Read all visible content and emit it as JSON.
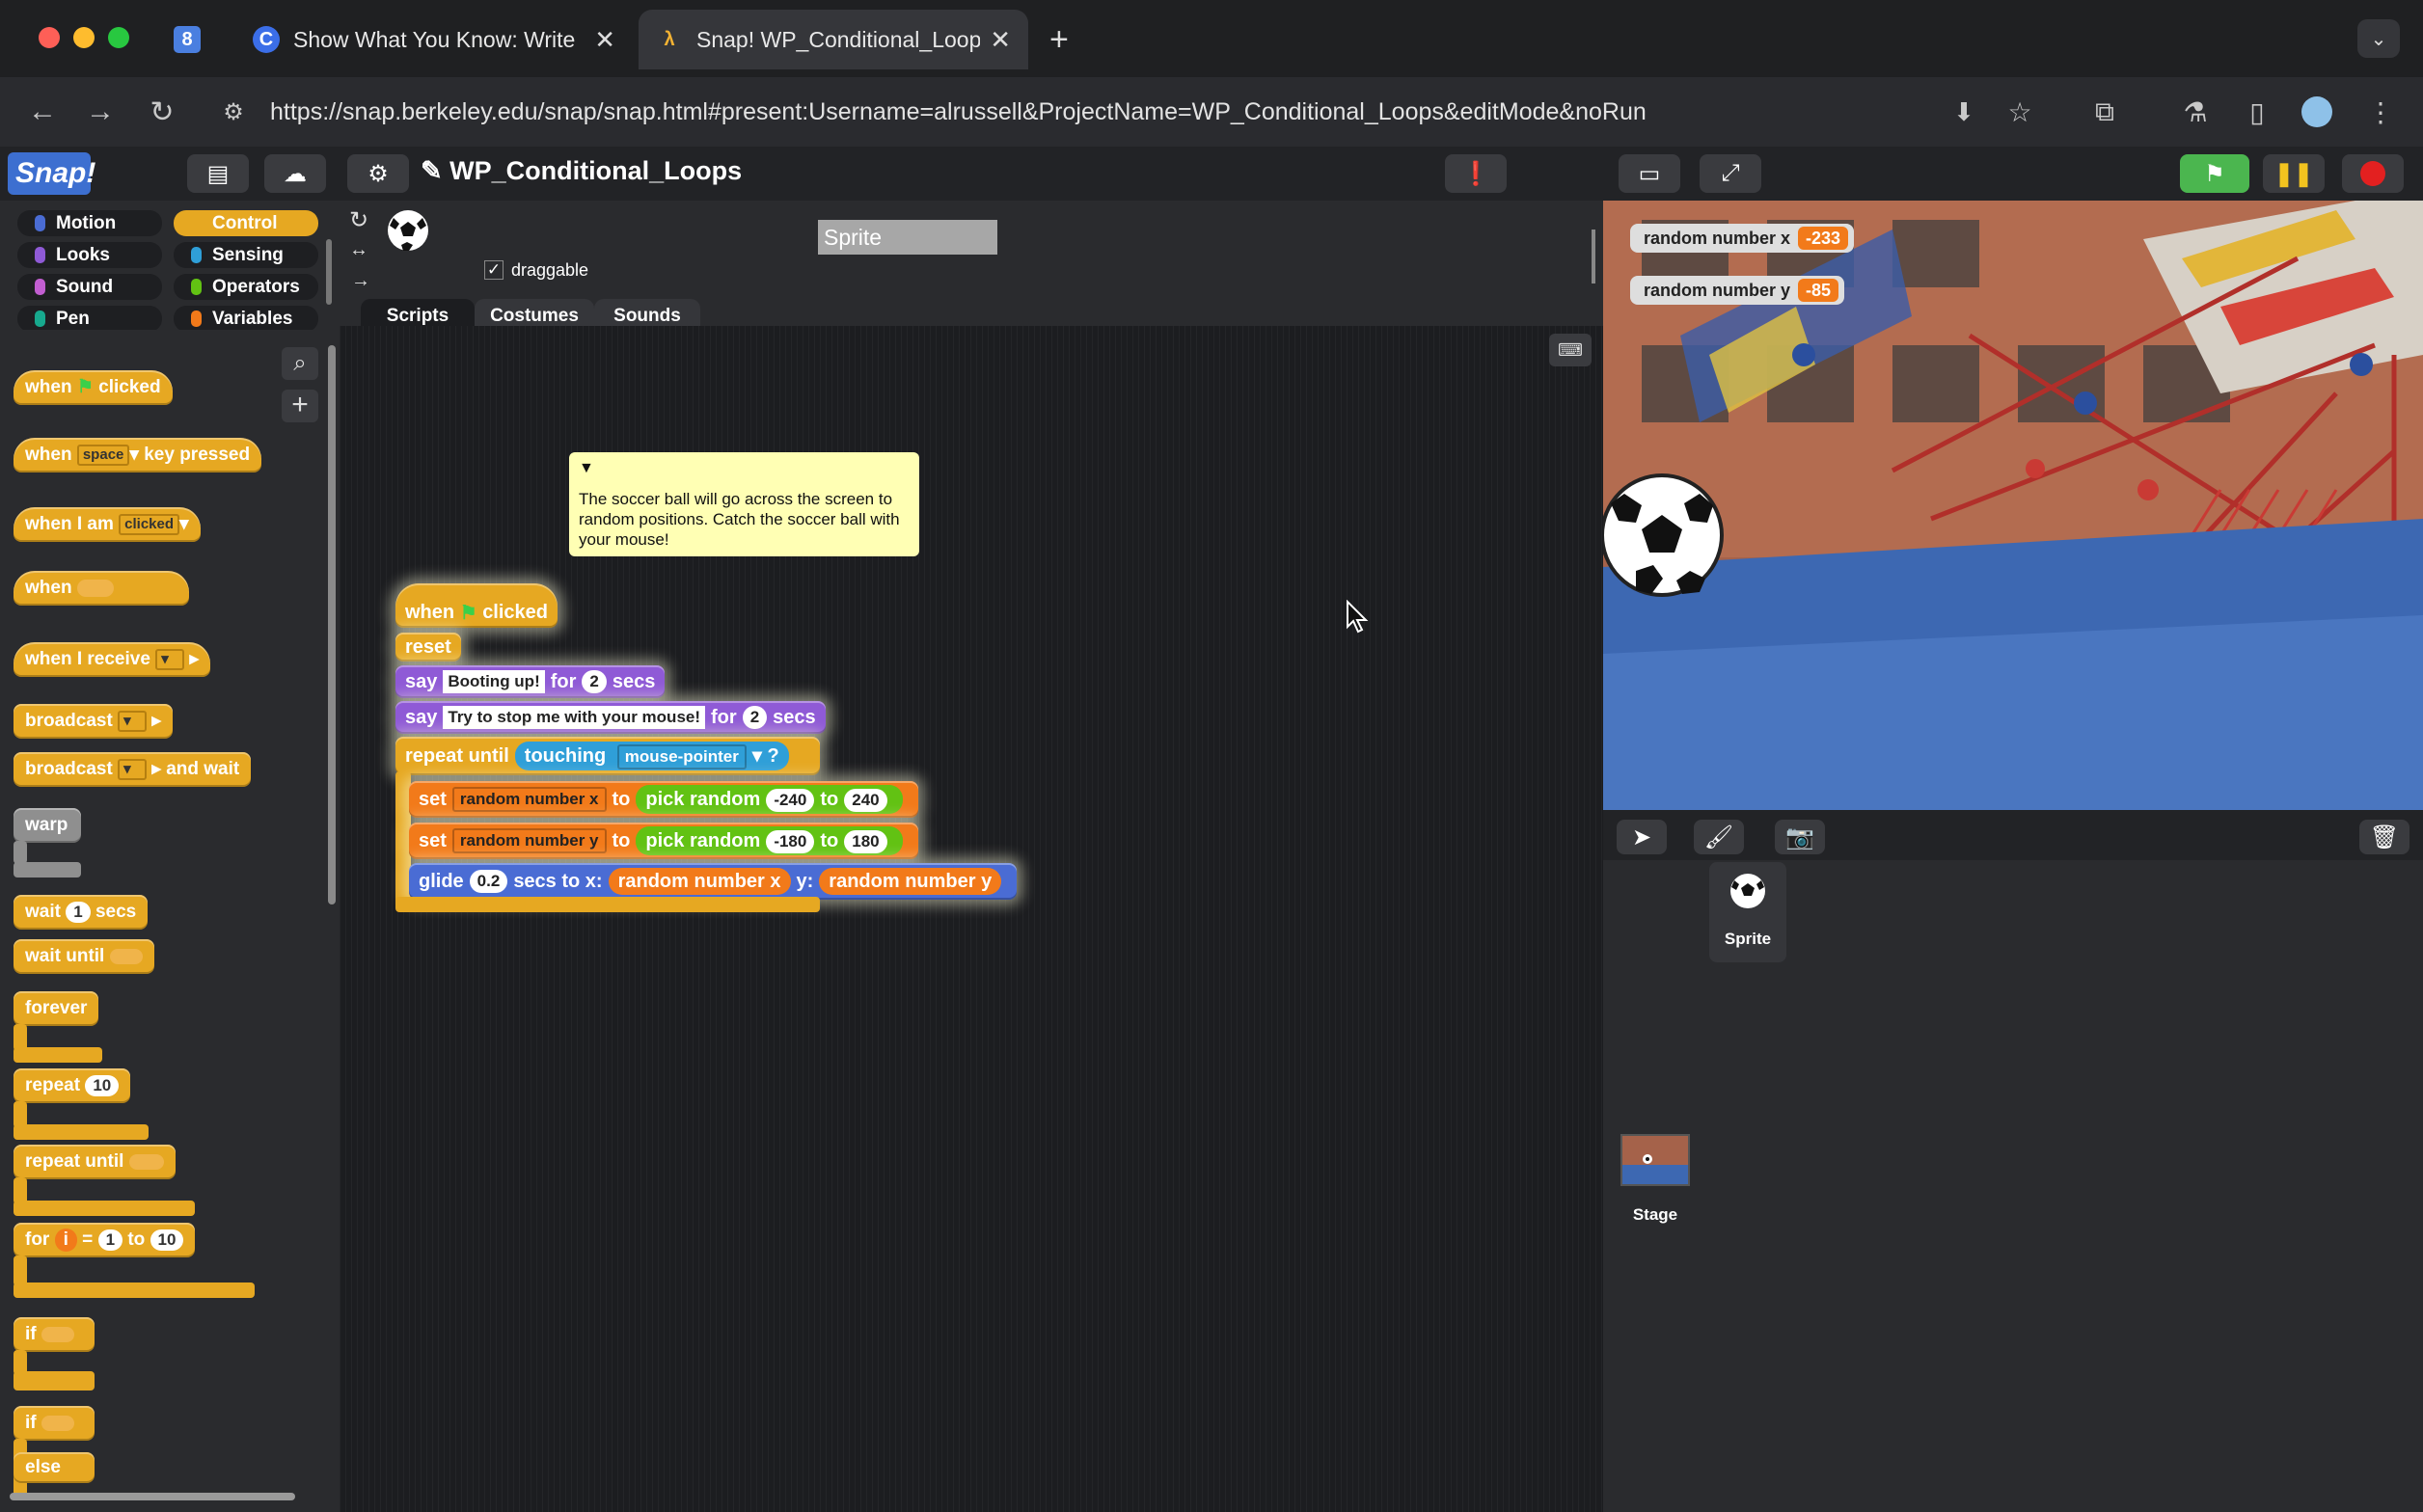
{
  "browser": {
    "tabs": [
      {
        "title": "",
        "favicon": "8"
      },
      {
        "title": "Show What You Know: Write",
        "favicon": "C"
      },
      {
        "title": "Snap! WP_Conditional_Loop",
        "favicon": "λ"
      }
    ],
    "new_tab": "+",
    "url": "https://snap.berkeley.edu/snap/snap.html#present:Username=alrussell&ProjectName=WP_Conditional_Loops&editMode&noRun"
  },
  "snap": {
    "logo": "Snap!",
    "project_name": "WP_Conditional_Loops",
    "categories": [
      "Motion",
      "Control",
      "Looks",
      "Sensing",
      "Sound",
      "Operators",
      "Pen",
      "Variables"
    ],
    "palette": {
      "when_flag": {
        "pre": "when",
        "post": "clicked"
      },
      "when_key": {
        "pre": "when",
        "key": "space",
        "post": "key pressed"
      },
      "when_i_am": {
        "pre": "when I am",
        "opt": "clicked"
      },
      "when": "when",
      "when_receive": "when I receive",
      "broadcast": "broadcast",
      "broadcast_wait": {
        "pre": "broadcast",
        "post": "and wait"
      },
      "warp": "warp",
      "wait": {
        "pre": "wait",
        "val": "1",
        "post": "secs"
      },
      "wait_until": "wait until",
      "forever": "forever",
      "repeat": {
        "pre": "repeat",
        "val": "10"
      },
      "repeat_until": "repeat until",
      "for": {
        "pre": "for",
        "var": "i",
        "eq": "=",
        "from": "1",
        "to": "to",
        "end": "10"
      },
      "if": "if",
      "if_else": {
        "if": "if",
        "else": "else"
      }
    },
    "sprite_name": "Sprite",
    "draggable_label": "draggable",
    "tabs": [
      "Scripts",
      "Costumes",
      "Sounds"
    ],
    "comment": "The soccer ball will go across the screen to random positions. Catch the soccer ball with your mouse!",
    "script": {
      "hat": {
        "pre": "when",
        "post": "clicked"
      },
      "reset": "reset",
      "say1": {
        "say": "say",
        "text": "Booting up!",
        "for": "for",
        "secs_val": "2",
        "secs": "secs"
      },
      "say2": {
        "say": "say",
        "text": "Try to stop me with your mouse!",
        "for": "for",
        "secs_val": "2",
        "secs": "secs"
      },
      "repeat_until": {
        "label": "repeat until",
        "touching": "touching",
        "target": "mouse-pointer",
        "q": "?"
      },
      "setx": {
        "set": "set",
        "var": "random number x",
        "to": "to",
        "pick": "pick random",
        "from": "-240",
        "to2": "to",
        "end": "240"
      },
      "sety": {
        "set": "set",
        "var": "random number y",
        "to": "to",
        "pick": "pick random",
        "from": "-180",
        "to2": "to",
        "end": "180"
      },
      "glide": {
        "glide": "glide",
        "secs_val": "0.2",
        "secs": "secs to x:",
        "x": "random number x",
        "y_label": "y:",
        "y": "random number y"
      }
    },
    "watchers": [
      {
        "label": "random number x",
        "value": "-233"
      },
      {
        "label": "random number y",
        "value": "-85"
      }
    ],
    "corral": {
      "sprite_label": "Sprite",
      "stage_label": "Stage"
    },
    "colors": {
      "control": "#e6a822",
      "looks": "#8f5ad6",
      "sensing": "#2f9fd8",
      "variables": "#f27a1a",
      "operators": "#62c213",
      "motion": "#4a6cd4"
    }
  }
}
